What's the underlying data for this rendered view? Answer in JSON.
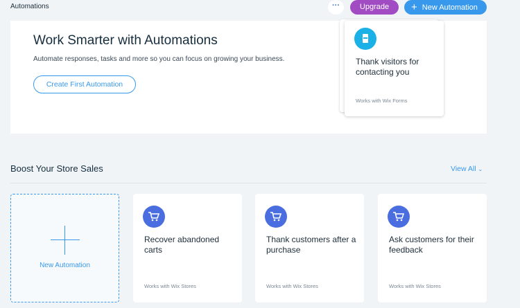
{
  "header": {
    "title": "Automations",
    "more_label": "···",
    "upgrade_label": "Upgrade",
    "new_automation_label": "New Automation"
  },
  "hero": {
    "title": "Work Smarter with Automations",
    "subtitle": "Automate responses, tasks and more so you can focus on growing your business.",
    "cta_label": "Create First Automation",
    "featured_card": {
      "icon": "form-icon",
      "title": "Thank visitors for contacting you",
      "works_with": "Works with Wix Forms"
    }
  },
  "section": {
    "title": "Boost Your Store Sales",
    "view_all_label": "View All",
    "new_card_label": "New Automation",
    "cards": [
      {
        "icon": "cart-icon",
        "title": "Recover abandoned carts",
        "works_with": "Works with Wix Stores"
      },
      {
        "icon": "cart-icon",
        "title": "Thank customers after a purchase",
        "works_with": "Works with Wix Stores"
      },
      {
        "icon": "cart-icon",
        "title": "Ask customers for their feedback",
        "works_with": "Works with Wix Stores"
      }
    ]
  },
  "colors": {
    "accent": "#3899ec",
    "upgrade": "#a24cc4",
    "store_icon": "#4a6ee0",
    "forms_icon": "#1bb1e6"
  }
}
